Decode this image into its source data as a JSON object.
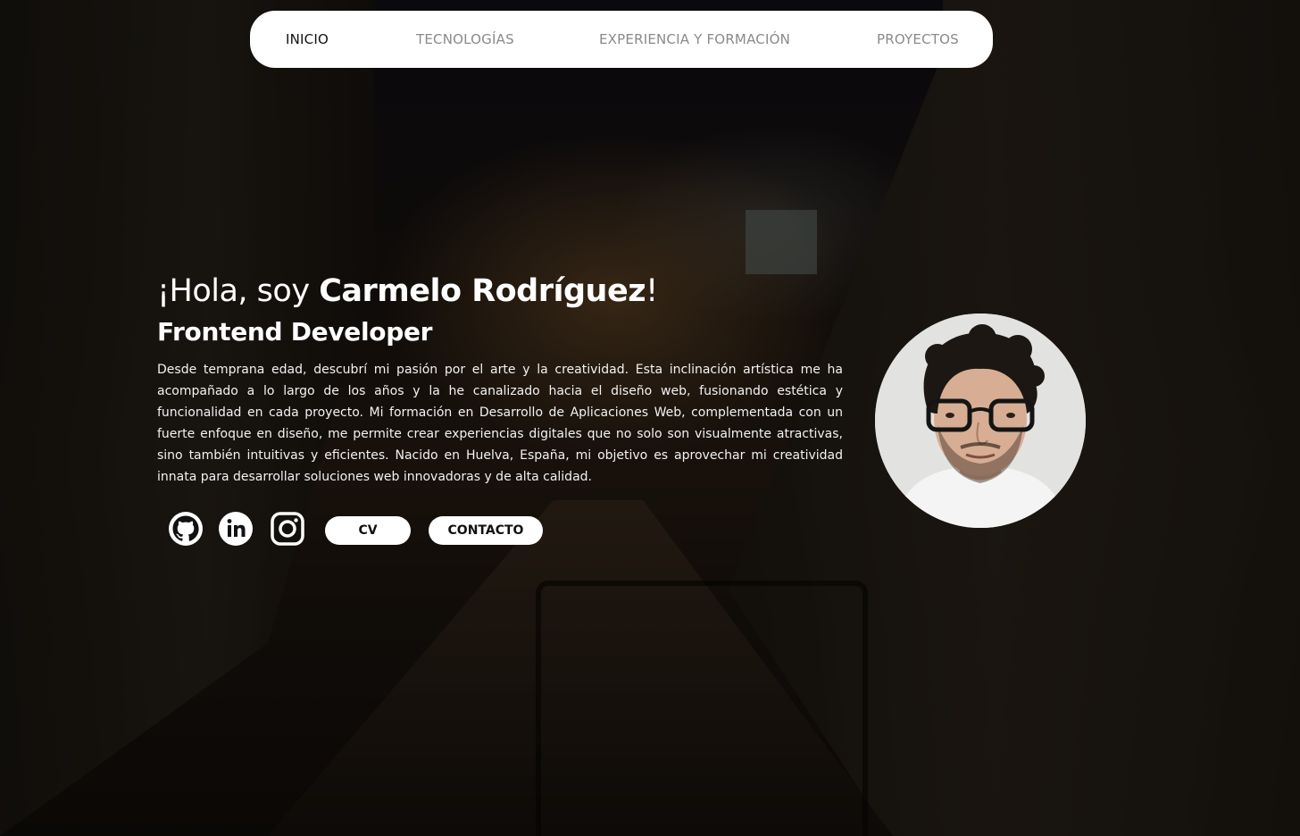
{
  "nav": {
    "items": [
      {
        "label": "INICIO",
        "active": true
      },
      {
        "label": "TECNOLOGÍAS",
        "active": false
      },
      {
        "label": "EXPERIENCIA Y FORMACIÓN",
        "active": false
      },
      {
        "label": "PROYECTOS",
        "active": false
      }
    ]
  },
  "hero": {
    "greeting_prefix": "¡Hola, soy ",
    "name": "Carmelo Rodríguez",
    "greeting_suffix": "!",
    "role": "Frontend Developer",
    "bio": "Desde temprana edad, descubrí mi pasión por el arte y la creatividad. Esta inclinación artística me ha acompañado a lo largo de los años y la he canalizado hacia el diseño web, fusionando estética y funcionalidad en cada proyecto. Mi formación en Desarrollo de Aplicaciones Web, complementada con un fuerte enfoque en diseño, me permite crear experiencias digitales que no solo son visualmente atractivas, sino también intuitivas y eficientes. Nacido en Huelva, España, mi objetivo es aprovechar mi creatividad innata para desarrollar soluciones web innovadoras y de alta calidad."
  },
  "social": {
    "icons": [
      "github-icon",
      "linkedin-icon",
      "instagram-icon"
    ]
  },
  "buttons": {
    "cv": "CV",
    "contact": "CONTACTO"
  },
  "colors": {
    "nav_bg": "#ffffff",
    "nav_active": "#111111",
    "nav_inactive": "#8a8a8a",
    "text": "#ffffff"
  }
}
